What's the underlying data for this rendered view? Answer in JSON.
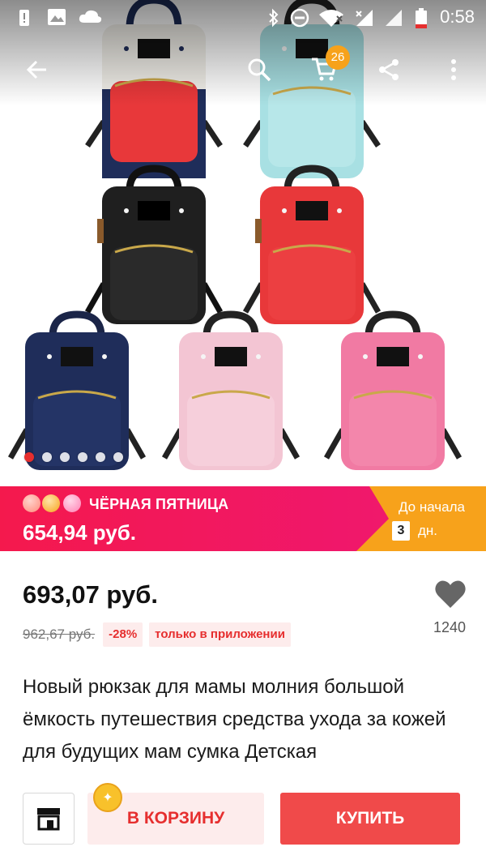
{
  "status_bar": {
    "time": "0:58",
    "icons": [
      "alert-icon",
      "gallery-icon",
      "cloud-icon",
      "bluetooth-icon",
      "do-not-disturb-icon",
      "wifi-icon",
      "signal-icon",
      "battery-icon"
    ]
  },
  "app_bar": {
    "back_icon": "arrow-left-icon",
    "search_icon": "search-icon",
    "cart_icon": "cart-icon",
    "cart_count": "26",
    "share_icon": "share-icon",
    "more_icon": "more-vertical-icon"
  },
  "gallery": {
    "image_count": 6,
    "active_index": 0,
    "bag_colors": [
      "#f2f0ea",
      "#a8e0e3",
      "#1f1f1f",
      "#e8383a",
      "#1f2d5a",
      "#f3c5d3",
      "#f17aa3"
    ]
  },
  "promo": {
    "title": "ЧЁРНАЯ ПЯТНИЦА",
    "price": "654,94 руб.",
    "until_label": "До начала",
    "days": "3",
    "days_unit": "дн."
  },
  "product": {
    "price": "693,07 руб.",
    "old_price": "962,67 руб.",
    "discount": "-28%",
    "app_only": "только в приложении",
    "wishlist_count": "1240",
    "title": "Новый рюкзак для мамы молния большой ёмкость путешествия средства ухода за кожей для будущих мам сумка Детская"
  },
  "bottom_bar": {
    "store_icon": "store-icon",
    "add_to_cart": "В КОРЗИНУ",
    "buy": "КУПИТЬ"
  },
  "colors": {
    "accent_red": "#e62e2e",
    "promo_pink": "#f0176a",
    "promo_orange": "#f7a21b",
    "buy_red": "#f04a4a"
  }
}
